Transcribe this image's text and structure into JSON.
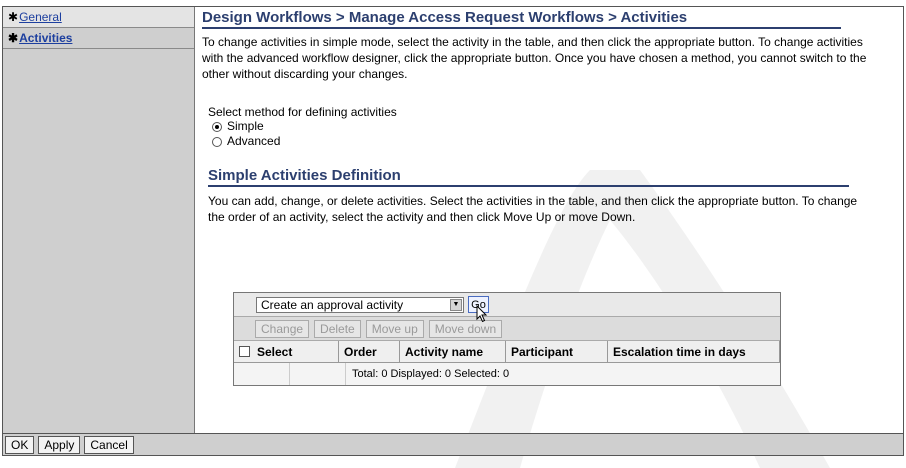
{
  "sidebar": {
    "items": [
      {
        "label": "General",
        "active": false
      },
      {
        "label": "Activities",
        "active": true
      }
    ]
  },
  "main": {
    "title": "Design Workflows > Manage Access Request Workflows > Activities",
    "description": "To change activities in simple mode, select the activity in the table, and then click the appropriate button. To change activities with the advanced workflow designer, click the appropriate button. Once you have chosen a method, you cannot switch to the other without discarding your changes.",
    "method_label": "Select method for defining activities",
    "methods": [
      {
        "label": "Simple",
        "checked": true
      },
      {
        "label": "Advanced",
        "checked": false
      }
    ],
    "section_title": "Simple Activities Definition",
    "section_description": "You can add, change, or delete activities. Select the activities in the table, and then click the appropriate button. To change the order of an activity, select the activity and then click Move Up or move Down."
  },
  "table": {
    "action_select": "Create an approval activity",
    "go_label": "Go",
    "buttons": [
      "Change",
      "Delete",
      "Move up",
      "Move down"
    ],
    "columns": [
      "Select",
      "Order",
      "Activity name",
      "Participant",
      "Escalation time in days"
    ],
    "footer": "Total: 0  Displayed: 0  Selected: 0"
  },
  "bottom": {
    "ok": "OK",
    "apply": "Apply",
    "cancel": "Cancel"
  },
  "colors": {
    "title": "#2c3f6f",
    "link": "#1d3f9f",
    "sidebar_bg": "#cfcfcf"
  }
}
